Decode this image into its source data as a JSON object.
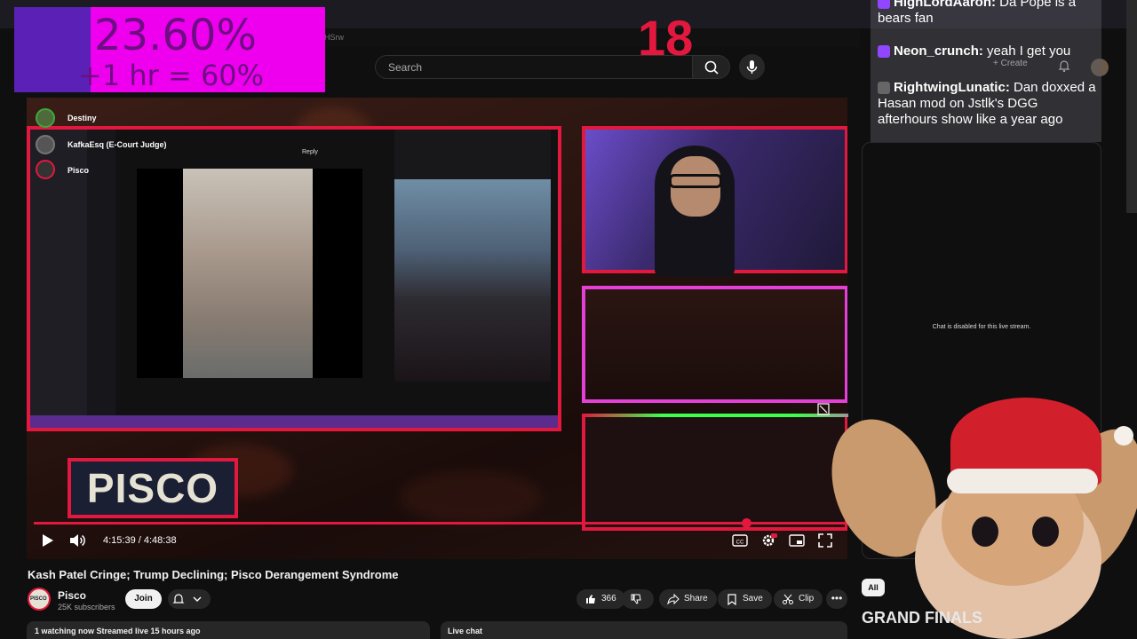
{
  "browser": {
    "url_fragment": "GHSrw"
  },
  "header": {
    "search_placeholder": "Search",
    "create_label": "Create"
  },
  "overlay": {
    "stat_main": "23.60%",
    "stat_sub": "+1 hr = 60%",
    "counter": "18"
  },
  "stream": {
    "streamer_tags": [
      "Destiny",
      "KafkaEsq (E-Court Judge)",
      "Pisco"
    ],
    "reply_label": "Reply",
    "logo_text": "PISCO"
  },
  "player": {
    "time_current": "4:15:39",
    "time_total": "4:48:38",
    "progress_fraction": 0.876
  },
  "chat_overlay": {
    "messages": [
      {
        "user": "HighLordAaron:",
        "text": "Da Pope is a bears fan"
      },
      {
        "user": "Neon_crunch:",
        "text": "yeah I get you"
      },
      {
        "user": "RightwingLunatic:",
        "text": "Dan doxxed a Hasan mod on Jstlk's DGG afterhours show like a year ago"
      }
    ]
  },
  "right_panel": {
    "chat_disabled": "Chat is disabled for this live stream.",
    "filter_all": "All",
    "promo_text": "GRAND FINALS"
  },
  "video": {
    "title": "Kash Patel Cringe; Trump Declining; Pisco Derangement Syndrome",
    "channel_name": "Pisco",
    "channel_subs": "25K subscribers",
    "avatar_text": "PISCO",
    "join_label": "Join",
    "like_count": "366",
    "share_label": "Share",
    "save_label": "Save",
    "clip_label": "Clip",
    "more_label": "•••",
    "meta": "1 watching now  Streamed live 15 hours ago",
    "live_chat_label": "Live chat"
  },
  "colors": {
    "accent_red": "#e2183f",
    "overlay_magenta": "#ee00ee",
    "twitch_purple": "#9146ff"
  }
}
